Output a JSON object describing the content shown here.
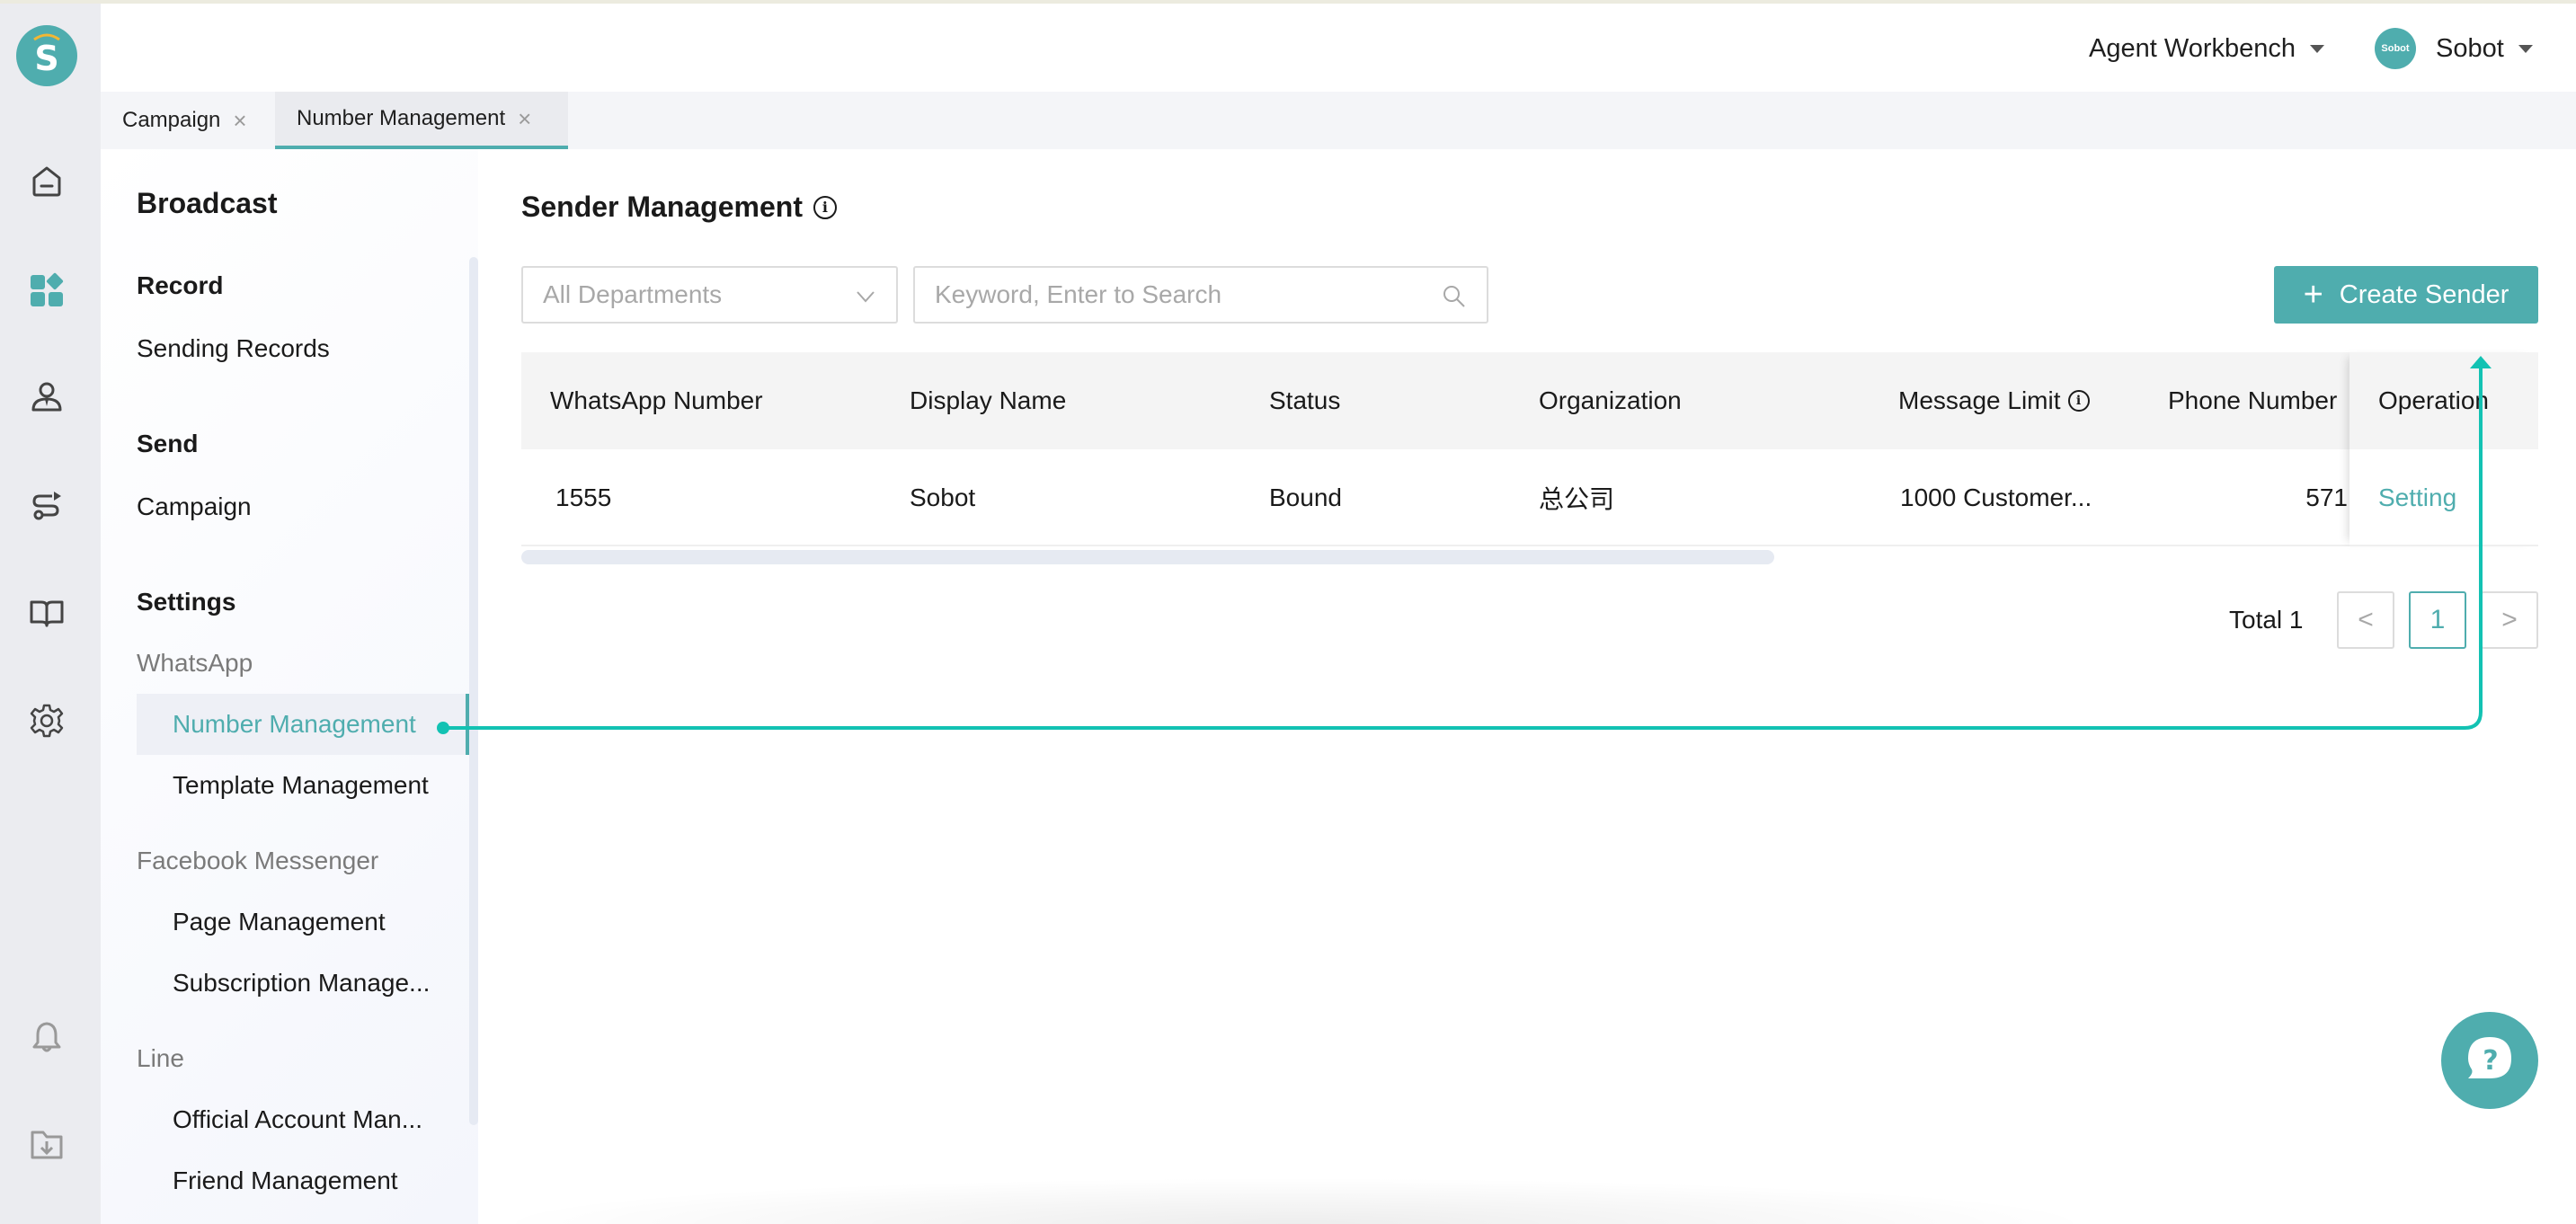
{
  "app": {
    "logo_letter": "S",
    "brand_color": "#4fadae"
  },
  "rail": {
    "icons": [
      {
        "name": "home-icon",
        "active": false
      },
      {
        "name": "apps-icon",
        "active": true
      },
      {
        "name": "agent-icon",
        "active": false
      },
      {
        "name": "route-icon",
        "active": false
      },
      {
        "name": "book-icon",
        "active": false
      },
      {
        "name": "gear-icon",
        "active": false
      },
      {
        "name": "bell-icon",
        "active": false
      },
      {
        "name": "folder-download-icon",
        "active": false
      }
    ]
  },
  "header": {
    "workbench_label": "Agent Workbench",
    "user_avatar_text": "Sobot",
    "user_name": "Sobot"
  },
  "tabs": [
    {
      "label": "Campaign",
      "close": "×",
      "active": false
    },
    {
      "label": "Number Management",
      "close": "×",
      "active": true
    }
  ],
  "nav": {
    "title": "Broadcast",
    "groups": {
      "record": "Record",
      "send": "Send",
      "settings": "Settings"
    },
    "links": {
      "sending_records": "Sending Records",
      "campaign": "Campaign"
    },
    "subgroups": {
      "whatsapp": "WhatsApp",
      "facebook": "Facebook Messenger",
      "line": "Line"
    },
    "items": {
      "number_management": "Number Management",
      "template_management": "Template Management",
      "page_management": "Page Management",
      "subscription_management": "Subscription Manage...",
      "official_account_management": "Official Account Man...",
      "friend_management": "Friend Management"
    }
  },
  "main": {
    "title": "Sender Management",
    "info_glyph": "i",
    "department_select": {
      "value": "All Departments"
    },
    "search": {
      "placeholder": "Keyword, Enter to Search",
      "value": ""
    },
    "create_button": {
      "icon": "+",
      "label": "Create Sender"
    },
    "table": {
      "columns": [
        "WhatsApp Number",
        "Display Name",
        "Status",
        "Organization",
        "Message Limit",
        "Phone Number",
        "Operation"
      ],
      "rows": [
        {
          "whatsapp_number": "1555",
          "display_name": "Sobot",
          "status": "Bound",
          "organization": "总公司",
          "message_limit": "1000 Customer...",
          "phone_number": "571",
          "operation": "Setting"
        }
      ]
    },
    "pagination": {
      "total_label": "Total 1",
      "prev": "<",
      "current_page": "1",
      "next": ">"
    }
  },
  "help": {
    "glyph": "?"
  },
  "annotation": {
    "color": "#13c2b3"
  }
}
